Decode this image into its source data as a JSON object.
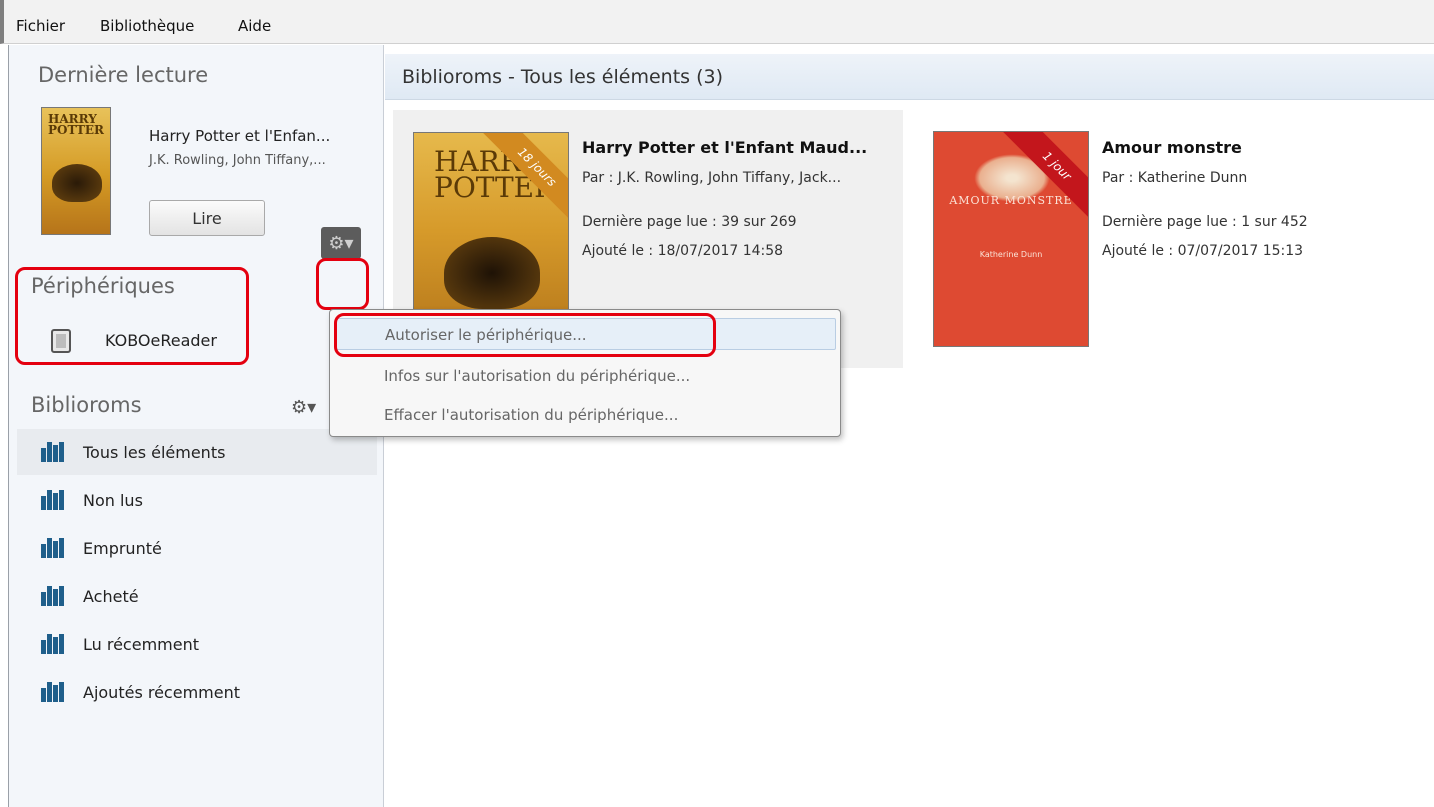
{
  "menubar": {
    "items": [
      "Fichier",
      "Bibliothèque",
      "Aide"
    ]
  },
  "sidebar": {
    "recent_title": "Dernière lecture",
    "recent_book": {
      "title": "Harry Potter et l'Enfan...",
      "author": "J.K. Rowling, John Tiffany,...",
      "read_label": "Lire"
    },
    "devices_title": "Périphériques",
    "device_name": "KOBOeReader",
    "biblio_title": "Biblioroms",
    "nav": [
      {
        "label": "Tous les éléments",
        "active": true
      },
      {
        "label": "Non lus"
      },
      {
        "label": "Emprunté"
      },
      {
        "label": "Acheté"
      },
      {
        "label": "Lu récemment"
      },
      {
        "label": "Ajoutés récemment"
      }
    ],
    "icons": {
      "gear": "gear-icon",
      "device": "tablet-icon",
      "shelf": "bookshelf-icon"
    }
  },
  "main": {
    "header": "Biblioroms - Tous les éléments (3)",
    "books": [
      {
        "title": "Harry Potter et l'Enfant Maud...",
        "author": "Par :  J.K. Rowling, John Tiffany, Jack...",
        "last_page": "Dernière page lue :  39 sur 269",
        "added": "Ajouté le :  18/07/2017 14:58",
        "ribbon": "18 jours",
        "cover_text": "HARRY POTTER"
      },
      {
        "title": "Amour monstre",
        "author": "Par :  Katherine Dunn",
        "last_page": "Dernière page lue :  1 sur 452",
        "added": "Ajouté le :  07/07/2017 15:13",
        "ribbon": "1 jour",
        "cover_text": "AMOUR MONSTRE",
        "cover_sub": "Katherine Dunn"
      }
    ]
  },
  "popup": {
    "items": [
      "Autoriser le périphérique...",
      "Infos sur l'autorisation du périphérique...",
      "Effacer l'autorisation du périphérique..."
    ]
  },
  "colors": {
    "highlight": "#e4000f",
    "header_bg": "#dfe9f4",
    "sidebar_bg": "#f3f6fa",
    "shelf_icon": "#1f5f8b"
  }
}
